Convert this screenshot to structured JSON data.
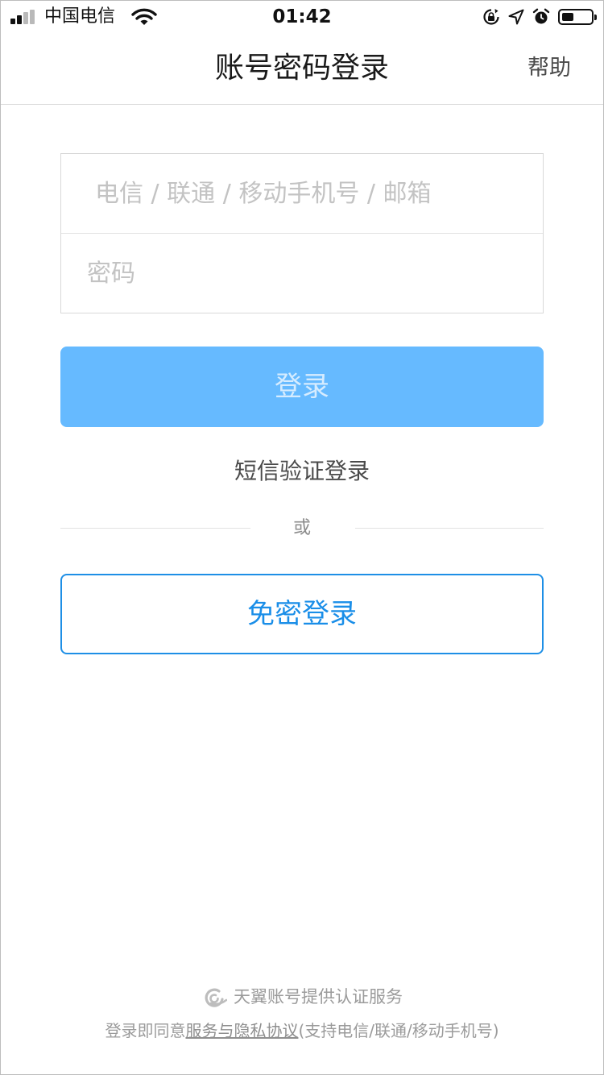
{
  "status_bar": {
    "carrier": "中国电信",
    "time": "01:42",
    "battery_level": 0.4,
    "icons": [
      "signal-icon",
      "wifi-icon",
      "rotation-lock-icon",
      "location-arrow-icon",
      "alarm-icon",
      "battery-icon"
    ]
  },
  "nav": {
    "title": "账号密码登录",
    "help": "帮助"
  },
  "form": {
    "account_placeholder": "电信 / 联通 / 移动手机号 / 邮箱",
    "account_value": "",
    "password_placeholder": "密码",
    "password_value": ""
  },
  "actions": {
    "login_label": "登录",
    "sms_login_label": "短信验证登录",
    "or_label": "或",
    "passwordless_label": "免密登录"
  },
  "footer": {
    "provider_text": "天翼账号提供认证服务",
    "agreement_prefix": "登录即同意",
    "agreement_link": "服务与隐私协议",
    "agreement_suffix": "(支持电信/联通/移动手机号)"
  },
  "colors": {
    "primary_blue": "#1e8fe6",
    "disabled_button": "#66baff",
    "text_gray": "#9b9b9b"
  }
}
